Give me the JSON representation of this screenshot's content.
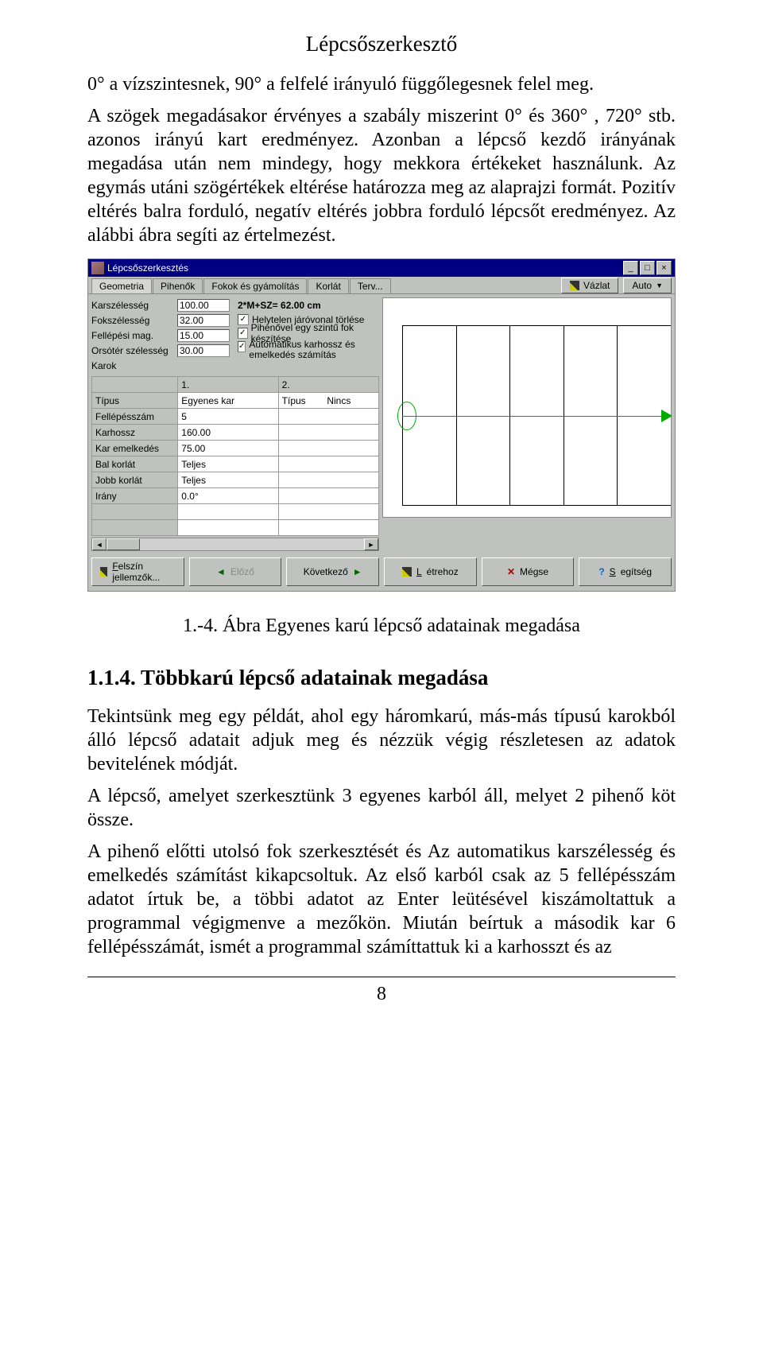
{
  "header_title": "Lépcsőszerkesztő",
  "para1": "0° a vízszintesnek, 90° a felfelé irányuló függőlegesnek felel meg.",
  "para2": "A szögek megadásakor érvényes a szabály miszerint 0° és 360° , 720° stb. azonos irányú kart eredményez. Azonban a lépcső kezdő irányának megadása után nem mindegy, hogy mekkora értékeket használunk. Az egymás utáni szögértékek eltérése határozza meg az alaprajzi formát. Pozitív eltérés balra forduló, negatív eltérés jobbra forduló lépcsőt eredményez. Az alábbi ábra segíti az értelmezést.",
  "dialog": {
    "title": "Lépcsőszerkesztés",
    "tabs": [
      "Geometria",
      "Pihenők",
      "Fokok és gyámolítás",
      "Korlát",
      "Terv..."
    ],
    "vazlat": "Vázlat",
    "auto": "Auto",
    "form": {
      "karsz_label": "Karszélesség",
      "karsz_val": "100.00",
      "foksz_label": "Fokszélesség",
      "foksz_val": "32.00",
      "fellep_label": "Fellépési mag.",
      "fellep_val": "15.00",
      "orsot_label": "Orsótér szélesség",
      "orsot_val": "30.00",
      "karok_label": "Karok",
      "eq": "2*M+SZ= 62.00 cm",
      "chk1": "Helytelen járóvonal törlése",
      "chk2": "Pihenővel egy szintű fok készítése",
      "chk3": "Automatikus karhossz és emelkedés számítás"
    },
    "table": {
      "h1": "1.",
      "h2": "2.",
      "r_tipus": "Típus",
      "v_tipus1": "Egyenes kar",
      "v_tipus2": "Típus",
      "v_tipus2v": "Nincs",
      "r_fell": "Fellépésszám",
      "v_fell": "5",
      "r_karh": "Karhossz",
      "v_karh": "160.00",
      "r_kare": "Kar emelkedés",
      "v_kare": "75.00",
      "r_balk": "Bal korlát",
      "v_balk": "Teljes",
      "r_jobk": "Jobb korlát",
      "v_jobk": "Teljes",
      "r_irany": "Irány",
      "v_irany": "0.0°"
    },
    "buttons": {
      "felszin": "Felszín jellemzők...",
      "elozo": "Előző",
      "kovetkezo": "Következő",
      "letrehoz": "Létrehoz",
      "megse": "Mégse",
      "segitseg": "Segítség"
    }
  },
  "caption": "1.-4. Ábra Egyenes karú lépcső adatainak megadása",
  "subhead": "1.1.4. Többkarú lépcső adatainak megadása",
  "para3": "Tekintsünk meg egy példát, ahol egy háromkarú, más-más típusú karokból álló lépcső adatait adjuk meg és nézzük végig részletesen az adatok bevitelének módját.",
  "para4": "A lépcső, amelyet szerkesztünk 3 egyenes karból áll, melyet  2 pihenő   köt össze.",
  "para5": "A pihenő előtti  utolsó fok szerkesztését és  Az automatikus karszélesség és emelkedés számítást kikapcsoltuk. Az első karból csak az 5 fellépésszám adatot írtuk be, a többi adatot az Enter leütésével kiszámoltattuk a programmal végigmenve a mezőkön. Miután beírtuk a második kar 6 fellépésszámát, ismét a programmal számíttattuk ki a karhosszt és az",
  "page_number": "8"
}
